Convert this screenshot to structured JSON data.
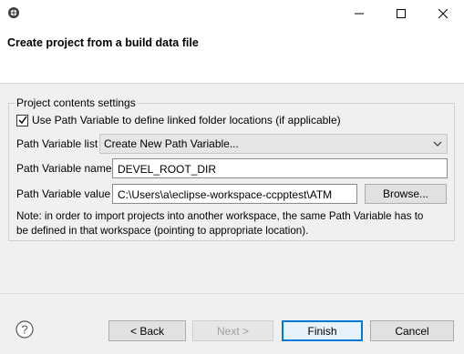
{
  "window": {
    "title_icon": "eclipse-cdt-icon",
    "minimize_icon": "minimize-icon",
    "maximize_icon": "maximize-icon",
    "close_icon": "close-icon"
  },
  "header": {
    "title": "Create project from a build data file"
  },
  "group": {
    "legend": "Project contents settings",
    "use_path_variable": {
      "label": "Use Path Variable to define linked folder locations (if applicable)",
      "checked": true
    },
    "path_variable_list": {
      "label": "Path Variable list",
      "selected": "Create New Path Variable..."
    },
    "path_variable_name": {
      "label": "Path Variable name",
      "value": "DEVEL_ROOT_DIR"
    },
    "path_variable_value": {
      "label": "Path Variable value",
      "value": "C:\\Users\\a\\eclipse-workspace-ccpptest\\ATM",
      "browse_label": "Browse..."
    },
    "note_line1": "Note: in order to import projects into another workspace, the same Path Variable has to",
    "note_line2": "be defined in that workspace (pointing to appropriate location)."
  },
  "footer": {
    "back_label": "< Back",
    "next_label": "Next >",
    "finish_label": "Finish",
    "cancel_label": "Cancel",
    "help_icon": "help-icon"
  },
  "colors": {
    "accent": "#0078d7",
    "dialog_bg": "#f0f0f0",
    "header_bg": "#ffffff"
  }
}
